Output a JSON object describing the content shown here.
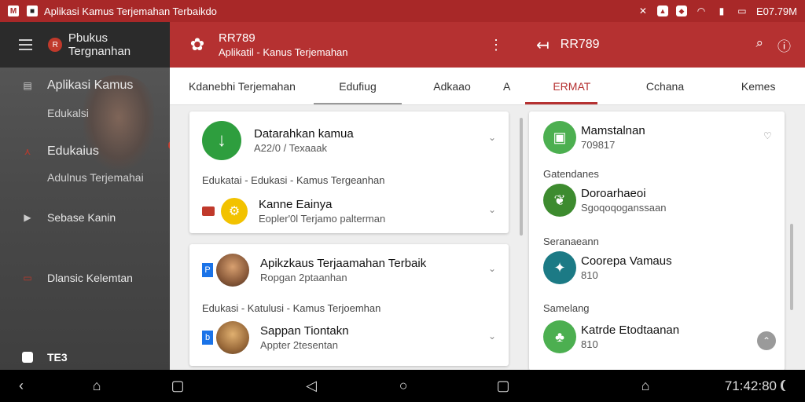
{
  "status_bar": {
    "app_badge": "M",
    "title": "Aplikasi Kamus Terjemahan Terbaikdo",
    "right_text": "E07.79M",
    "icons": [
      "no-sound-icon",
      "photo-icon",
      "shield-icon",
      "wifi-icon",
      "signal-icon",
      "battery-icon"
    ]
  },
  "drawer": {
    "header_title": "Pbukus Tergnanhan",
    "items": [
      {
        "label": "Aplikasi Kamus",
        "icon": "save-icon"
      },
      {
        "label": "Edukalsi",
        "icon": ""
      },
      {
        "label": "Edukaius",
        "icon": "ai-icon"
      },
      {
        "label": "Adulnus Terjemahai",
        "icon": ""
      },
      {
        "label": "Sebase Kanin",
        "icon": "play-icon"
      },
      {
        "label": "Dlansic Kelemtan",
        "icon": "video-icon"
      }
    ],
    "footer": "TE3"
  },
  "middle": {
    "title": "RR789",
    "subtitle": "Aplikatil - Kanus Terjemahan",
    "tabs": [
      "Kdanebhi Terjemahan",
      "Edufiug",
      "Adkaao",
      "A"
    ],
    "cards": [
      {
        "row1_title": "Datarahkan kamua",
        "row1_sub": "A22/0 / Texaaak",
        "caption": "Edukatai - Edukasi - Kamus Tergeanhan",
        "row2_title": "Kanne Eainya",
        "row2_sub": "Eopler'0l Terjamo palterman"
      },
      {
        "row1_title": "Apikzkaus Terjaamahan Terbaik",
        "row1_sub": "Ropgan 2ptaanhan",
        "caption": "Edukasi - Katulusi - Kamus Terjoemhan",
        "row2_title": "Sappan Tiontakn",
        "row2_sub": "Appter 2tesentan"
      }
    ]
  },
  "right": {
    "title": "RR789",
    "tabs": [
      "ERMAT",
      "Cchana",
      "Kemes"
    ],
    "sections": [
      {
        "header": "",
        "title": "Mamstalnan",
        "sub": "709817",
        "color": "#4caf50"
      },
      {
        "header": "Gatendanes",
        "title": "Doroarhaeoi",
        "sub": "Sgoqoqoganssaan",
        "color": "#3d8b2f"
      },
      {
        "header": "Seranaeann",
        "title": "Coorepa Vamaus",
        "sub": "810",
        "color": "#1c7a85"
      },
      {
        "header": "Samelang",
        "title": "Katrde Etodtaanan",
        "sub": "810",
        "color": "#4caf50"
      }
    ]
  },
  "nav_bar": {
    "time": "71:42:80"
  },
  "colors": {
    "primary": "#b53131",
    "statusbar": "#a82828",
    "accent_green": "#2e9e3e",
    "accent_yellow": "#f2c200"
  }
}
